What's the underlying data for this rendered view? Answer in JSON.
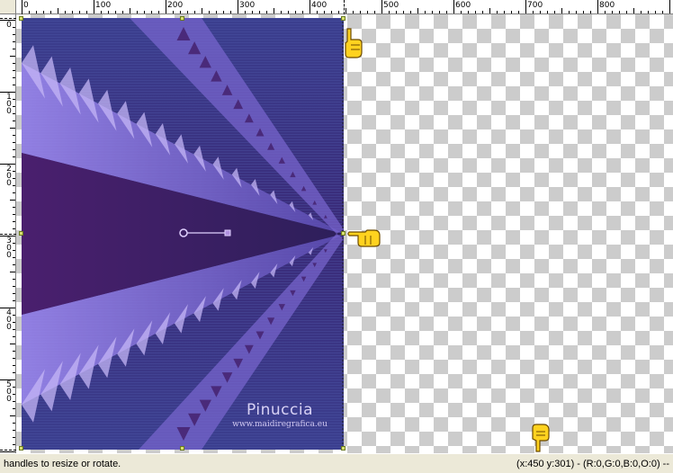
{
  "rulers": {
    "horizontal_labels": [
      "0",
      "100",
      "200",
      "300",
      "400",
      "500",
      "600",
      "700",
      "800"
    ],
    "vertical_labels": [
      [
        "0"
      ],
      [
        "1",
        "0",
        "0"
      ],
      [
        "2",
        "0",
        "0"
      ],
      [
        "3",
        "0",
        "0"
      ],
      [
        "4",
        "0",
        "0"
      ],
      [
        "5",
        "0",
        "0"
      ]
    ]
  },
  "canvas": {
    "layer_colors": {
      "base": "#3a3d8c",
      "deep": "#3b1f66",
      "light": "#8f7ae0",
      "pale": "#b9a8f0"
    }
  },
  "watermark": {
    "title": "Pinuccia",
    "url": "www.maidiregrafica.eu"
  },
  "tool": {
    "cursor_icon": "pointing-hand-icon",
    "handle_color": "#d8e070"
  },
  "statusbar": {
    "hint": "handles to resize or rotate.",
    "coords": "(x:450 y:301) - (R:0,G:0,B:0,O:0) --"
  }
}
